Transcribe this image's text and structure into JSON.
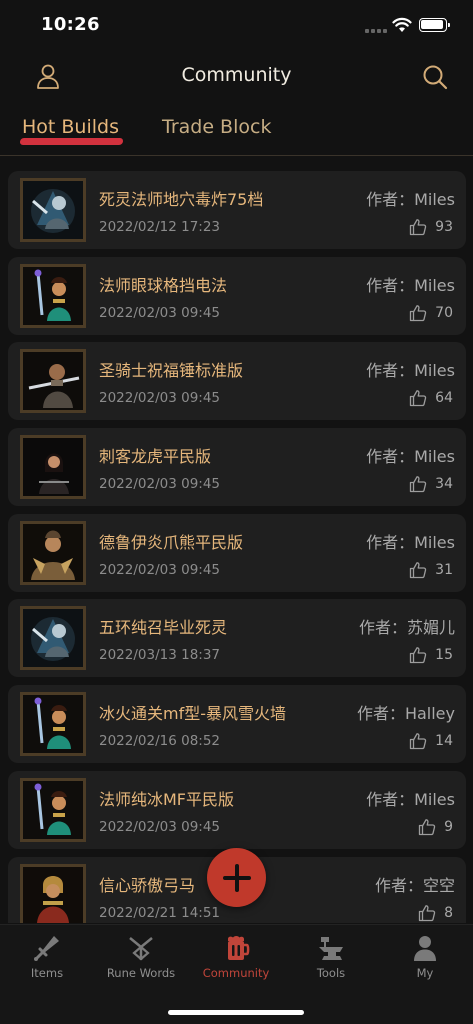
{
  "status_bar": {
    "time": "10:26"
  },
  "nav": {
    "title": "Community"
  },
  "tabs": [
    {
      "label": "Hot Builds",
      "active": true
    },
    {
      "label": "Trade Block",
      "active": false
    }
  ],
  "builds": [
    {
      "title": "死灵法师地穴毒炸75档",
      "author": "作者：Miles",
      "date": "2022/02/12 17:23",
      "likes": "93",
      "avatar": "necromancer-portrait"
    },
    {
      "title": "法师眼球格挡电法",
      "author": "作者：Miles",
      "date": "2022/02/03 09:45",
      "likes": "70",
      "avatar": "sorceress-portrait"
    },
    {
      "title": "圣骑士祝福锤标准版",
      "author": "作者：Miles",
      "date": "2022/02/03 09:45",
      "likes": "64",
      "avatar": "paladin-portrait"
    },
    {
      "title": "刺客龙虎平民版",
      "author": "作者：Miles",
      "date": "2022/02/03 09:45",
      "likes": "34",
      "avatar": "assassin-portrait"
    },
    {
      "title": "德鲁伊炎爪熊平民版",
      "author": "作者：Miles",
      "date": "2022/02/03 09:45",
      "likes": "31",
      "avatar": "druid-portrait"
    },
    {
      "title": "五环纯召毕业死灵",
      "author": "作者：苏媚儿",
      "date": "2022/03/13 18:37",
      "likes": "15",
      "avatar": "necromancer-portrait"
    },
    {
      "title": "冰火通关mf型-暴风雪火墙",
      "author": "作者：Halley",
      "date": "2022/02/16 08:52",
      "likes": "14",
      "avatar": "sorceress-portrait"
    },
    {
      "title": "法师纯冰MF平民版",
      "author": "作者：Miles",
      "date": "2022/02/03 09:45",
      "likes": "9",
      "avatar": "sorceress-portrait"
    },
    {
      "title": "信心骄傲弓马",
      "author": "作者：空空",
      "date": "2022/02/21 14:51",
      "likes": "8",
      "avatar": "amazon-portrait"
    }
  ],
  "tab_bar": {
    "items": [
      {
        "label": "Items",
        "icon": "sword-icon",
        "active": false
      },
      {
        "label": "Rune Words",
        "icon": "rune-icon",
        "active": false
      },
      {
        "label": "Community",
        "icon": "mug-icon",
        "active": true
      },
      {
        "label": "Tools",
        "icon": "anvil-icon",
        "active": false
      },
      {
        "label": "My",
        "icon": "person-icon",
        "active": false
      }
    ]
  },
  "colors": {
    "accent": "#e6b77c",
    "active_tab_underline": "#d2323e",
    "fab": "#c0392b",
    "tab_active_label": "#c0453a",
    "card_background": "#1f1f1f",
    "page_background": "#121212"
  }
}
